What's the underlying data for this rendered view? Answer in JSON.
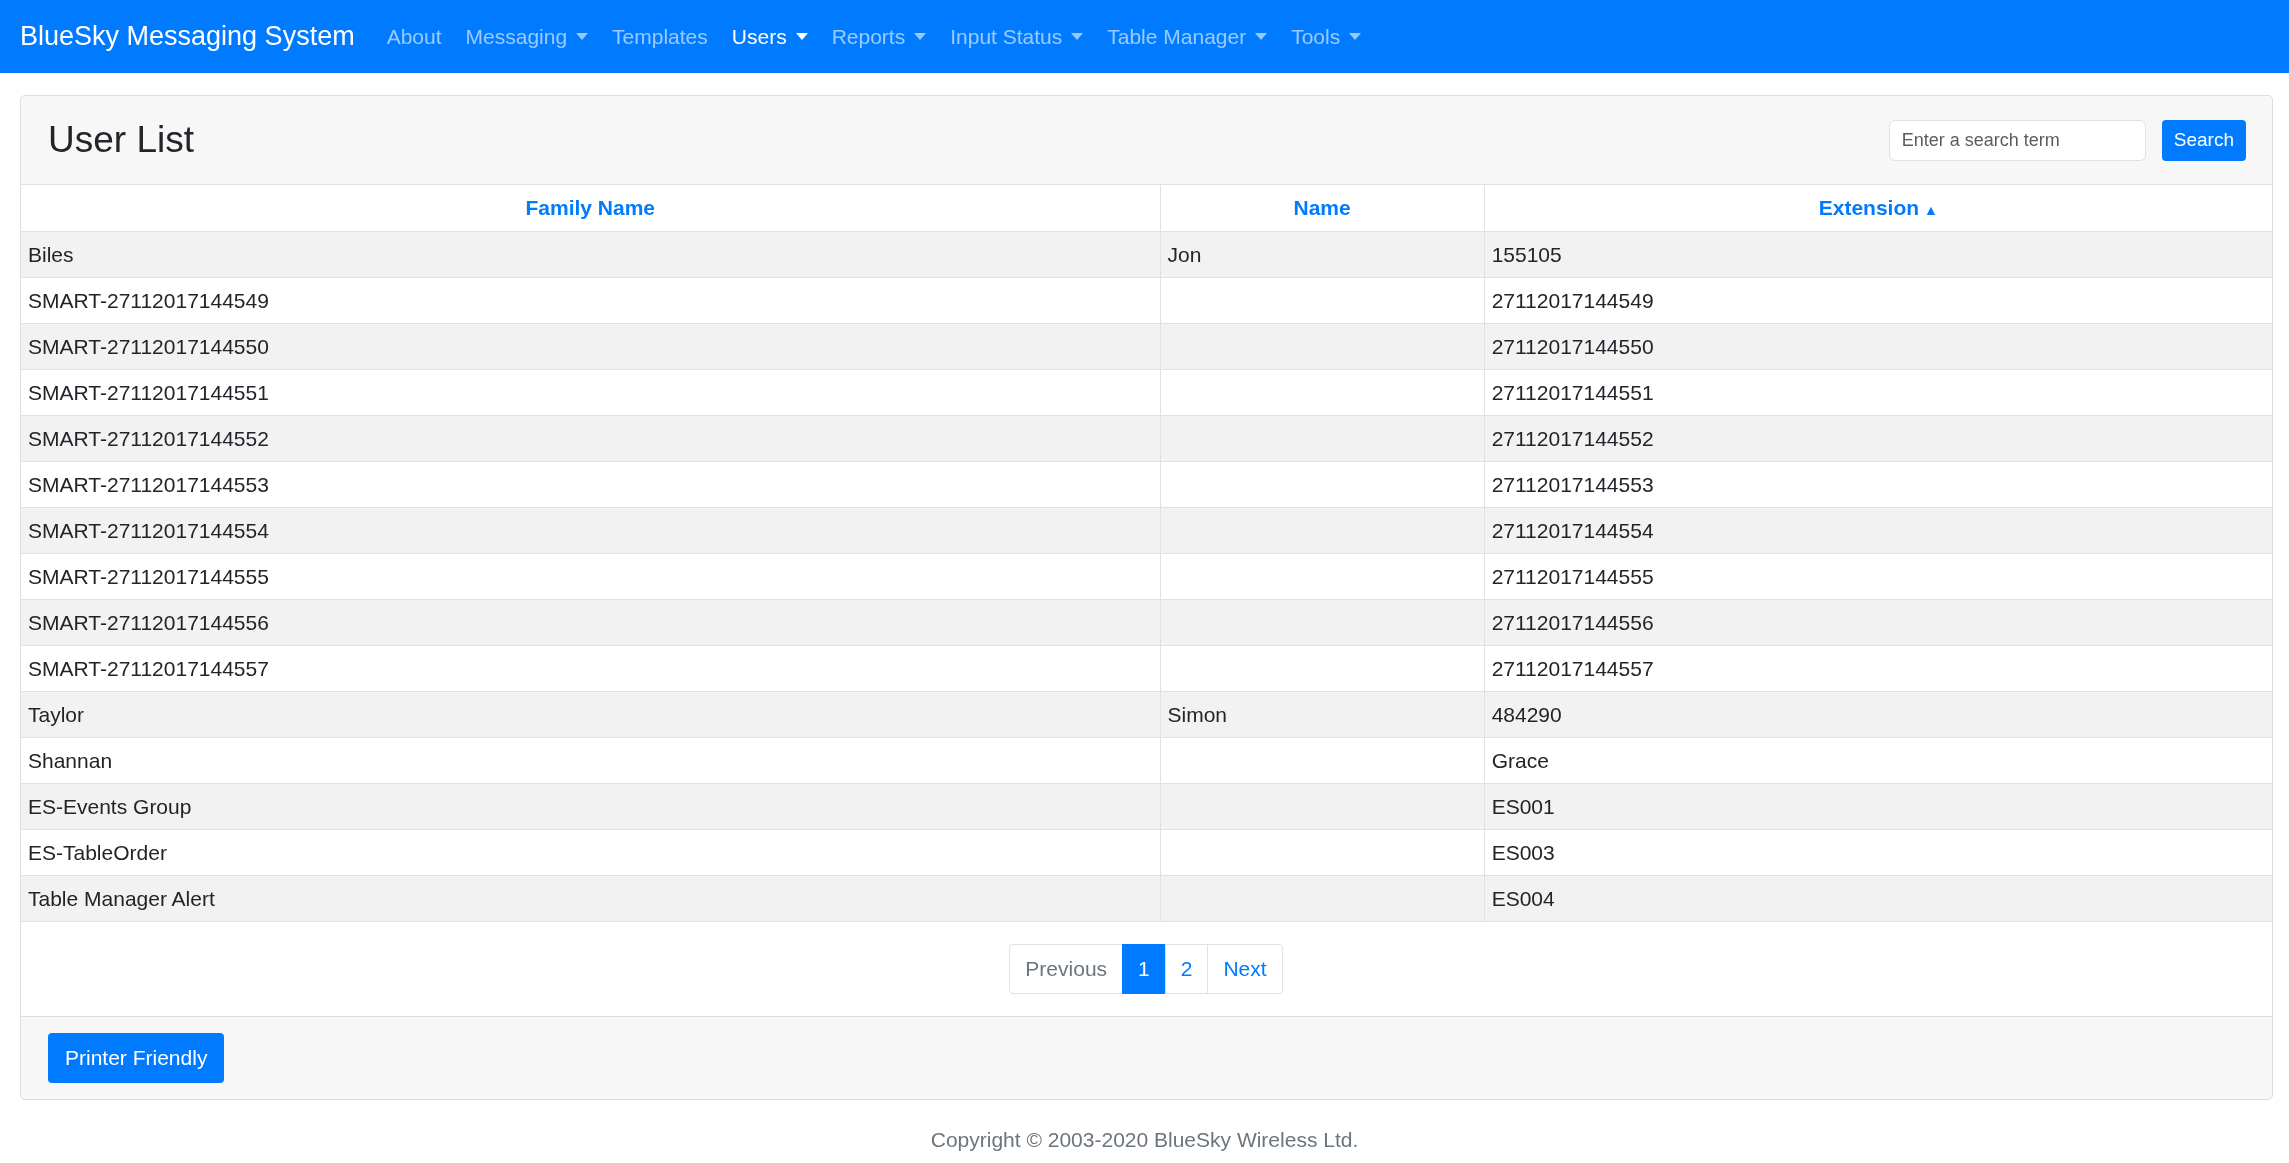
{
  "navbar": {
    "brand": "BlueSky Messaging System",
    "items": [
      {
        "label": "About",
        "dropdown": false,
        "selected": false
      },
      {
        "label": "Messaging",
        "dropdown": true,
        "selected": false
      },
      {
        "label": "Templates",
        "dropdown": false,
        "selected": false
      },
      {
        "label": "Users",
        "dropdown": true,
        "selected": true
      },
      {
        "label": "Reports",
        "dropdown": true,
        "selected": false
      },
      {
        "label": "Input Status",
        "dropdown": true,
        "selected": false
      },
      {
        "label": "Table Manager",
        "dropdown": true,
        "selected": false
      },
      {
        "label": "Tools",
        "dropdown": true,
        "selected": false
      }
    ]
  },
  "card": {
    "title": "User List",
    "search": {
      "placeholder": "Enter a search term",
      "button": "Search"
    },
    "table": {
      "columns": [
        {
          "label": "Family Name"
        },
        {
          "label": "Name"
        },
        {
          "label": "Extension",
          "sort": "▲"
        }
      ],
      "rows": [
        [
          "Biles",
          "Jon",
          "155105"
        ],
        [
          "SMART-27112017144549",
          "",
          "27112017144549"
        ],
        [
          "SMART-27112017144550",
          "",
          "27112017144550"
        ],
        [
          "SMART-27112017144551",
          "",
          "27112017144551"
        ],
        [
          "SMART-27112017144552",
          "",
          "27112017144552"
        ],
        [
          "SMART-27112017144553",
          "",
          "27112017144553"
        ],
        [
          "SMART-27112017144554",
          "",
          "27112017144554"
        ],
        [
          "SMART-27112017144555",
          "",
          "27112017144555"
        ],
        [
          "SMART-27112017144556",
          "",
          "27112017144556"
        ],
        [
          "SMART-27112017144557",
          "",
          "27112017144557"
        ],
        [
          "Taylor",
          "Simon",
          "484290"
        ],
        [
          "Shannan",
          "",
          "Grace"
        ],
        [
          "ES-Events Group",
          "",
          "ES001"
        ],
        [
          "ES-TableOrder",
          "",
          "ES003"
        ],
        [
          "Table Manager Alert",
          "",
          "ES004"
        ]
      ]
    },
    "pagination": [
      {
        "label": "Previous",
        "disabled": true,
        "selected": false
      },
      {
        "label": "1",
        "disabled": false,
        "selected": true
      },
      {
        "label": "2",
        "disabled": false,
        "selected": false
      },
      {
        "label": "Next",
        "disabled": false,
        "selected": false
      }
    ],
    "footer_button": "Printer Friendly"
  },
  "copyright": "Copyright © 2003-2020 BlueSky Wireless Ltd."
}
